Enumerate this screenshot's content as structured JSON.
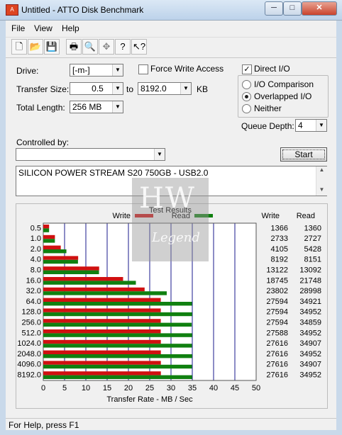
{
  "window": {
    "title": "Untitled - ATTO Disk Benchmark",
    "minimize": "─",
    "maximize": "□",
    "close": "✕"
  },
  "menu": {
    "file": "File",
    "view": "View",
    "help": "Help"
  },
  "toolbar_icons": [
    "new-icon",
    "open-icon",
    "save-icon",
    "print-icon",
    "print-preview-icon",
    "move-icon",
    "help-icon",
    "context-help-icon"
  ],
  "settings": {
    "drive_label": "Drive:",
    "drive_value": "[-m-]",
    "force_write_label": "Force Write Access",
    "force_write_checked": false,
    "transfer_size_label": "Transfer Size:",
    "transfer_from": "0.5",
    "to_label": "to",
    "transfer_to": "8192.0",
    "kb_label": "KB",
    "total_length_label": "Total Length:",
    "total_length_value": "256 MB",
    "direct_io_label": "Direct I/O",
    "direct_io_checked": true,
    "io_comparison_label": "I/O Comparison",
    "overlapped_io_label": "Overlapped I/O",
    "neither_label": "Neither",
    "selected_io_mode": "overlapped",
    "queue_depth_label": "Queue Depth:",
    "queue_depth_value": "4",
    "controlled_by_label": "Controlled by:",
    "controlled_by_value": "",
    "start_label": "Start",
    "description": "SILICON POWER STREAM S20 750GB - USB2.0"
  },
  "watermark": {
    "letters": "HW",
    "word": "Legend"
  },
  "status": {
    "text": "For Help, press F1"
  },
  "chart_data": {
    "type": "bar",
    "title": "Test Results",
    "legend": [
      {
        "name": "Write",
        "color": "#d01010"
      },
      {
        "name": "Read",
        "color": "#108010"
      }
    ],
    "col_headers": {
      "write": "Write",
      "read": "Read"
    },
    "categories": [
      "0.5",
      "1.0",
      "2.0",
      "4.0",
      "8.0",
      "16.0",
      "32.0",
      "64.0",
      "128.0",
      "256.0",
      "512.0",
      "1024.0",
      "2048.0",
      "4096.0",
      "8192.0"
    ],
    "series": [
      {
        "name": "Write",
        "color": "#d01010",
        "values": [
          1366,
          2733,
          4105,
          8192,
          13122,
          18745,
          23802,
          27594,
          27594,
          27594,
          27588,
          27616,
          27616,
          27616,
          27616
        ]
      },
      {
        "name": "Read",
        "color": "#108010",
        "values": [
          1360,
          2727,
          5428,
          8151,
          13092,
          21748,
          28998,
          34921,
          34952,
          34859,
          34952,
          34907,
          34952,
          34907,
          34952
        ]
      }
    ],
    "write_labels": [
      "1366",
      "2733",
      "4105",
      "8192",
      "13122",
      "18745",
      "23802",
      "27594",
      "27594",
      "27594",
      "27588",
      "27616",
      "27616",
      "27616",
      "27616"
    ],
    "read_labels": [
      "1360",
      "2727",
      "5428",
      "8151",
      "13092",
      "21748",
      "28998",
      "34921",
      "34952",
      "34859",
      "34952",
      "34907",
      "34952",
      "34907",
      "34952"
    ],
    "xticks": [
      "0",
      "5",
      "10",
      "15",
      "20",
      "25",
      "30",
      "35",
      "40",
      "45",
      "50"
    ],
    "xlim": [
      0,
      50
    ],
    "xlabel": "Transfer Rate - MB / Sec",
    "value_unit_divisor": 1000,
    "grid": true,
    "grid_color": "#1a1a8c"
  }
}
